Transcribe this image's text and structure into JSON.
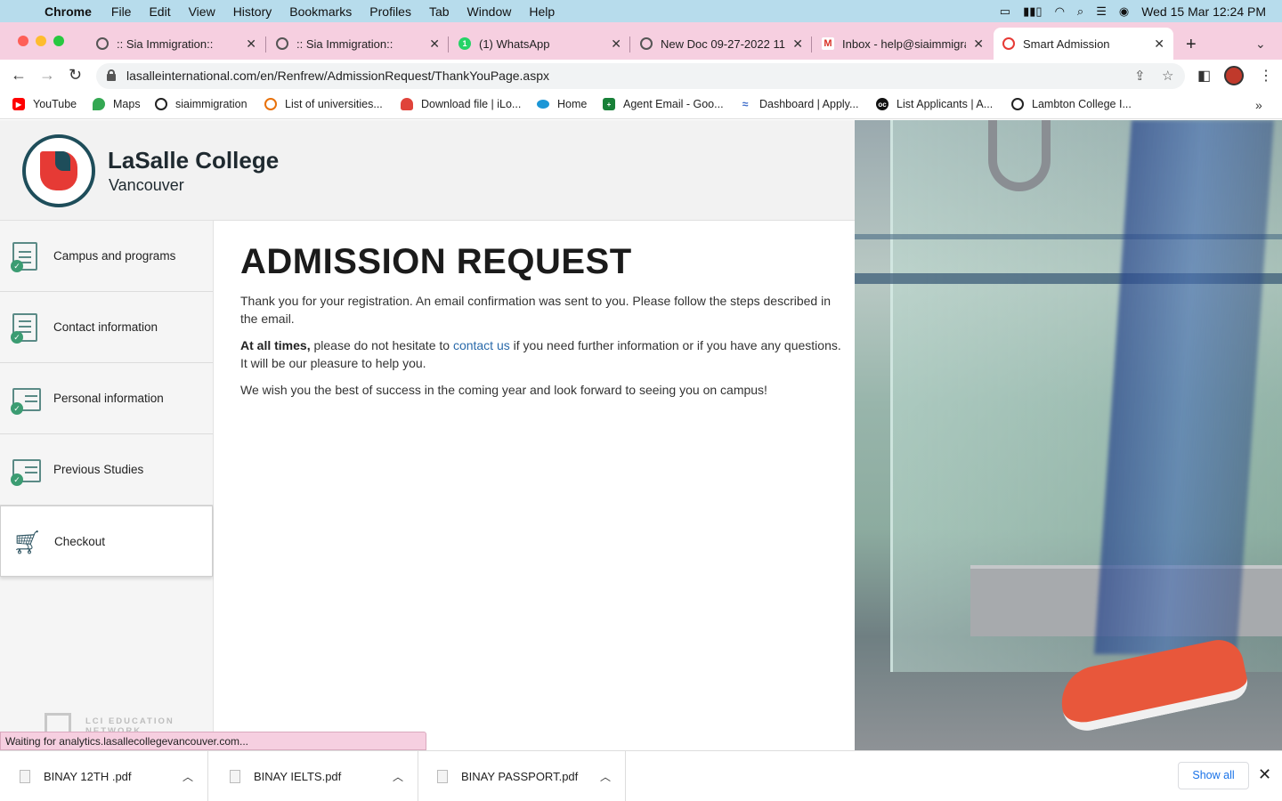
{
  "menubar": {
    "app": "Chrome",
    "items": [
      "File",
      "Edit",
      "View",
      "History",
      "Bookmarks",
      "Profiles",
      "Tab",
      "Window",
      "Help"
    ],
    "clock": "Wed 15 Mar  12:24 PM"
  },
  "tabs": [
    {
      "title": ":: Sia Immigration::",
      "favicon": "globe-icon",
      "active": false
    },
    {
      "title": ":: Sia Immigration::",
      "favicon": "globe-icon",
      "active": false
    },
    {
      "title": "(1) WhatsApp",
      "favicon": "whatsapp-icon",
      "active": false
    },
    {
      "title": "New Doc 09-27-2022 11",
      "favicon": "globe-icon",
      "active": false
    },
    {
      "title": "Inbox - help@siaimmigra",
      "favicon": "gmail-icon",
      "active": false
    },
    {
      "title": "Smart Admission",
      "favicon": "lasalle-icon",
      "active": true
    }
  ],
  "address_bar": {
    "url": "lasalleinternational.com/en/Renfrew/AdmissionRequest/ThankYouPage.aspx"
  },
  "bookmarks": [
    {
      "label": "YouTube",
      "icon": "youtube-icon",
      "color": "#ff0000"
    },
    {
      "label": "Maps",
      "icon": "maps-icon",
      "color": "#34a853"
    },
    {
      "label": "siaimmigration",
      "icon": "globe-icon",
      "color": "#222222"
    },
    {
      "label": "List of universities...",
      "icon": "list-icon",
      "color": "#e8710a"
    },
    {
      "label": "Download file | iLo...",
      "icon": "heart-icon",
      "color": "#e0433a"
    },
    {
      "label": "Home",
      "icon": "cloud-icon",
      "color": "#1b96d6"
    },
    {
      "label": "Agent Email - Goo...",
      "icon": "sheets-icon",
      "color": "#188038"
    },
    {
      "label": "Dashboard | Apply...",
      "icon": "cap-icon",
      "color": "#3b6ac9"
    },
    {
      "label": "List Applicants | A...",
      "icon": "oc-icon",
      "color": "#111111"
    },
    {
      "label": "Lambton College I...",
      "icon": "globe-icon",
      "color": "#222222"
    }
  ],
  "brand": {
    "name": "LaSalle College",
    "sub": "Vancouver"
  },
  "steps": [
    {
      "label": "Campus and programs",
      "done": true
    },
    {
      "label": "Contact information",
      "done": true
    },
    {
      "label": "Personal information",
      "done": true
    },
    {
      "label": "Previous Studies",
      "done": true
    },
    {
      "label": "Checkout",
      "done": false,
      "active": true
    }
  ],
  "network_logo": {
    "line1": "LCI EDUCATION",
    "line2": "NETWORK"
  },
  "main": {
    "title": "ADMISSION REQUEST",
    "p1": "Thank you for your registration. An email confirmation was sent to you. Please follow the steps described in the email.",
    "p2_bold": "At all times,",
    "p2_a": " please do not hesitate to ",
    "p2_link": "contact us",
    "p2_b": " if you need further information or if you have any questions. It will be our pleasure to help you.",
    "p3": "We wish you the best of success in the coming year and look forward to seeing you on campus!"
  },
  "status_text": "Waiting for analytics.lasallecollegevancouver.com...",
  "downloads": {
    "items": [
      "BINAY 12TH .pdf",
      "BINAY IELTS.pdf",
      "BINAY PASSPORT.pdf"
    ],
    "show_all": "Show all"
  },
  "colors": {
    "menubar": "#b7dcec",
    "tabstrip": "#f6cfe0",
    "brand_red": "#e63a35",
    "brand_teal": "#1e4d5a",
    "link": "#2a6aaa"
  }
}
